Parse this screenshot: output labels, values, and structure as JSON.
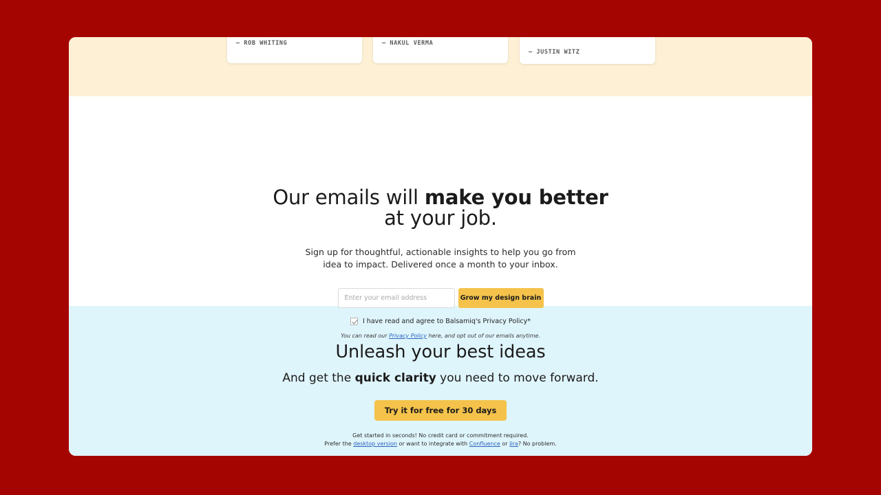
{
  "colors": {
    "page_background": "#A50500",
    "testimonial_band": "#FDF0D4",
    "newsletter_band": "#FFFFFF",
    "cta_band": "#DFF5FC",
    "accent_button": "#F5C34B",
    "link": "#2A62BC"
  },
  "testimonials": {
    "cards": [
      {
        "author": "— ROB WHITING"
      },
      {
        "author": "— NAKUL VERMA"
      },
      {
        "author": "— JUSTIN WITZ"
      }
    ]
  },
  "newsletter": {
    "heading_prefix": "Our emails will ",
    "heading_bold": "make you better",
    "heading_suffix": "at your job.",
    "subtitle_line1": "Sign up for thoughtful, actionable insights to help you go from",
    "subtitle_line2": "idea to impact. Delivered once a month to your inbox.",
    "email_placeholder": "Enter your email address",
    "email_value": "",
    "submit_label": "Grow my design brain",
    "consent_label": "I have read and agree to Balsamiq's Privacy Policy*",
    "consent_checked": true,
    "fineprint_prefix": "You can read our ",
    "fineprint_link": "Privacy Policy",
    "fineprint_suffix": " here, and opt out of our emails anytime."
  },
  "cta": {
    "heading": "Unleash your best ideas",
    "sub_prefix": "And get the ",
    "sub_bold": "quick clarity",
    "sub_suffix": " you need to move forward.",
    "button_label": "Try it for free for 30 days",
    "note_line1": "Get started in seconds! No credit card or commitment required.",
    "note_prefix": "Prefer the ",
    "note_link_desktop": "desktop version",
    "note_mid1": " or want to integrate with ",
    "note_link_confluence": "Confluence",
    "note_mid2": " or ",
    "note_link_jira": "Jira",
    "note_suffix": "? No problem."
  }
}
